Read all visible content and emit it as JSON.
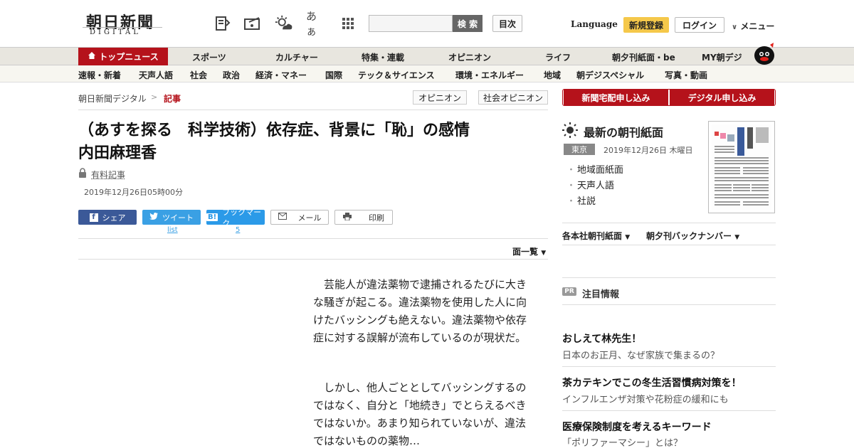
{
  "header": {
    "logo_jp": "朝日新聞",
    "logo_en": "DIGITAL",
    "search_placeholder": "",
    "search_button": "検 索",
    "toc_button": "目次",
    "language": "Language",
    "signup": "新規登録",
    "login": "ログイン",
    "menu": "メニュー",
    "font_size_label": "あぁ"
  },
  "nav": {
    "top_news": "トップニュース",
    "items": [
      "スポーツ",
      "カルチャー",
      "特集・連載",
      "オピニオン",
      "ライフ",
      "朝夕刊紙面・be",
      "MY朝デジ"
    ],
    "sub_items": [
      "速報・新着",
      "天声人語",
      "社会",
      "政治",
      "経済・マネー",
      "国際",
      "テック＆サイエンス",
      "環境・エネルギー",
      "地域",
      "朝デジスペシャル",
      "写真・動画"
    ]
  },
  "breadcrumb": {
    "home": "朝日新聞デジタル",
    "separator": ">",
    "current": "記事"
  },
  "tags": [
    "オピニオン",
    "社会オピニオン"
  ],
  "article": {
    "headline_line1": "（あすを探る　科学技術）依存症、背景に「恥」の感情",
    "headline_line2": "内田麻理香",
    "paid_label": "有料記事",
    "date": "2019年12月26日05時00分",
    "share": {
      "facebook": "シェア",
      "twitter": "ツイート",
      "twitter_count": "list",
      "hatena": "ブックマーク",
      "hatena_count": "5",
      "mail": "メール",
      "print": "印刷"
    },
    "page_list": "面一覧",
    "paragraphs": [
      "芸能人が違法薬物で逮捕されるたびに大きな騒ぎが起こる。違法薬物を使用した人に向けたバッシングも絶えない。違法薬物や依存症に対する誤解が流布しているのが現状だ。",
      "しかし、他人ごととしてバッシングするのではなく、自分と「地続き」でとらえるべきではないか。あまり知られていないが、違法ではないものの薬物…"
    ]
  },
  "sidebar": {
    "btn_delivery": "新聞宅配申し込み",
    "btn_digital": "デジタル申し込み",
    "paper_title": "最新の朝刊紙面",
    "paper_location": "東京",
    "paper_date": "2019年12月26日 木曜日",
    "paper_links": [
      "地域面紙面",
      "天声人語",
      "社説"
    ],
    "dropdown1": "各本社朝刊紙面",
    "dropdown2": "朝夕刊バックナンバー",
    "pr_badge": "PR",
    "pr_title": "注目情報",
    "ads": [
      {
        "title": "おしえて林先生！",
        "sub": "日本のお正月、なぜ家族で集まるの？"
      },
      {
        "title": "茶カテキンでこの冬生活習慣病対策を！",
        "sub": "インフルエンザ対策や花粉症の緩和にも"
      },
      {
        "title": "医療保険制度を考えるキーワード",
        "sub": "「ポリファーマシー」とは？"
      }
    ]
  },
  "colors": {
    "brand_red": "#b5121b",
    "signup_yellow": "#f5c84a",
    "facebook": "#3b5998",
    "twitter": "#3aa0e4"
  }
}
